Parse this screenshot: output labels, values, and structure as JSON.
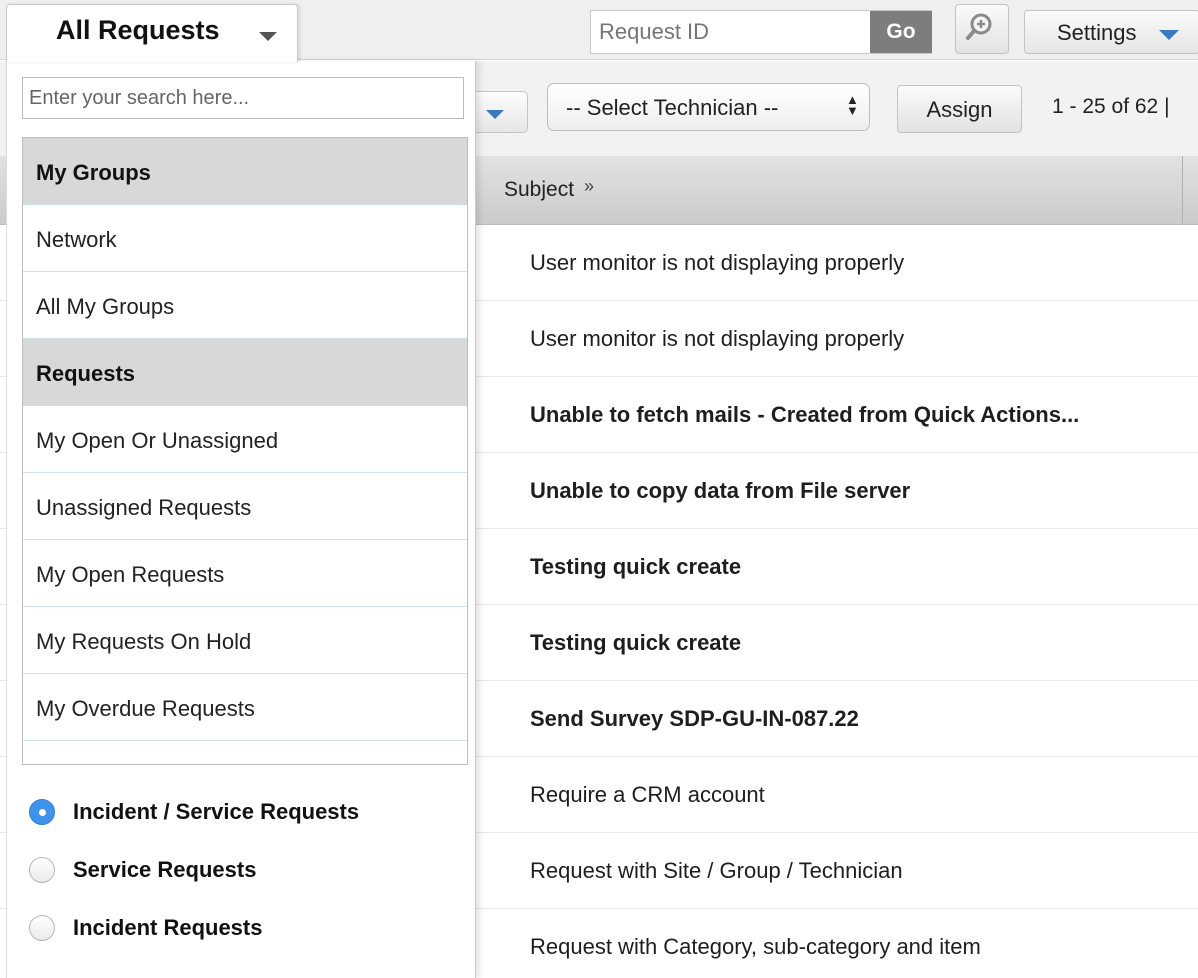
{
  "header": {
    "view_title": "All Requests",
    "request_id_placeholder": "Request ID",
    "go_label": "Go",
    "settings_label": "Settings"
  },
  "icons": {
    "view_caret": "chevron-down-icon",
    "quick_search": "search-plus-icon",
    "settings_caret": "chevron-down-icon",
    "select_arrows": "up-down-icon"
  },
  "colors": {
    "accent_blue": "#3a78c2",
    "radio_selected": "#3f93ea",
    "go_button": "#7d7d7d",
    "group_header_bg": "#d8d8d8"
  },
  "toolbar": {
    "technician_select": "-- Select Technician --",
    "assign_label": "Assign",
    "paging": "1 - 25 of 62 |"
  },
  "filter_panel": {
    "search_placeholder": "Enter your search here...",
    "groups": [
      {
        "title": "My Groups",
        "items": [
          "Network",
          "All My Groups"
        ]
      },
      {
        "title": "Requests",
        "items": [
          "My Open Or Unassigned",
          "Unassigned Requests",
          "My Open Requests",
          "My Requests On Hold",
          "My Overdue Requests"
        ]
      }
    ],
    "request_types": [
      {
        "label": "Incident / Service Requests",
        "selected": true
      },
      {
        "label": "Service Requests",
        "selected": false
      },
      {
        "label": "Incident Requests",
        "selected": false
      }
    ]
  },
  "table": {
    "columns": {
      "subject": "Subject"
    },
    "rows": [
      {
        "subject": "User monitor is not displaying properly",
        "bold": false
      },
      {
        "subject": "User monitor is not displaying properly",
        "bold": false
      },
      {
        "subject": "Unable to fetch mails - Created from Quick Actions...",
        "bold": true
      },
      {
        "subject": "Unable to copy data from File server",
        "bold": true
      },
      {
        "subject": "Testing quick create",
        "bold": true
      },
      {
        "subject": "Testing quick create",
        "bold": true
      },
      {
        "subject": "Send Survey SDP-GU-IN-087.22",
        "bold": true
      },
      {
        "subject": "Require a CRM account",
        "bold": false
      },
      {
        "subject": "Request with Site / Group / Technician",
        "bold": false
      },
      {
        "subject": "Request with Category, sub-category and item",
        "bold": false
      }
    ]
  }
}
